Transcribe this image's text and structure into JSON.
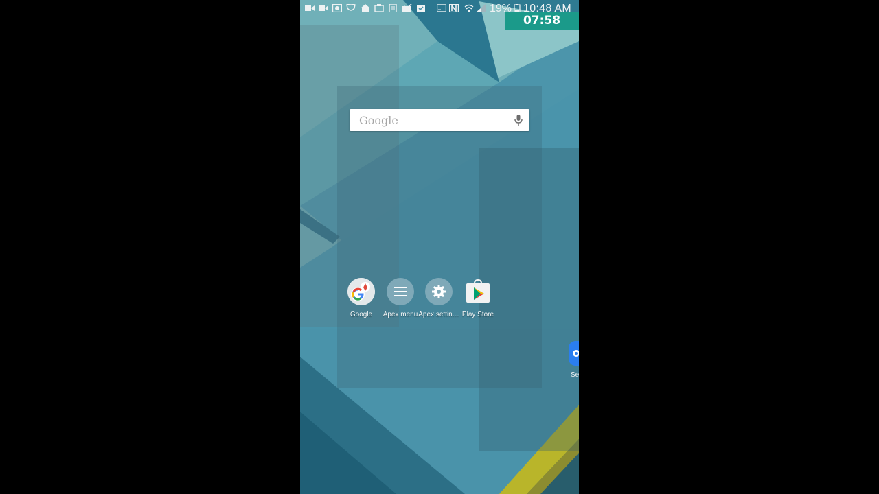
{
  "status_bar": {
    "icons": [
      "video-camera-icon",
      "video-camera-icon",
      "photo-icon",
      "shield-icon",
      "home-icon",
      "photo-icon",
      "doc-icon",
      "mail-check-icon",
      "clipboard-check-icon",
      "cast-icon",
      "nfc-icon",
      "wifi-icon",
      "signal-icon",
      "battery-icon"
    ],
    "battery_percent": "19%",
    "time": "10:48 AM"
  },
  "timer_badge": "07:58",
  "search_widget": {
    "logo_text": "Google",
    "mic": "mic-icon"
  },
  "apps": [
    {
      "label": "Google",
      "icon": "google-folder-icon"
    },
    {
      "label": "Apex menu",
      "icon": "menu-icon"
    },
    {
      "label": "Apex settin…",
      "icon": "settings-gear-icon"
    },
    {
      "label": "Play Store",
      "icon": "play-store-icon"
    }
  ],
  "edge_app": {
    "label": "Se",
    "icon": "settings-app-icon"
  },
  "colors": {
    "timer_bg": "#1b9a8a",
    "wallpaper_base": "#4f97ad",
    "accent_yellow": "#b9b52a"
  }
}
